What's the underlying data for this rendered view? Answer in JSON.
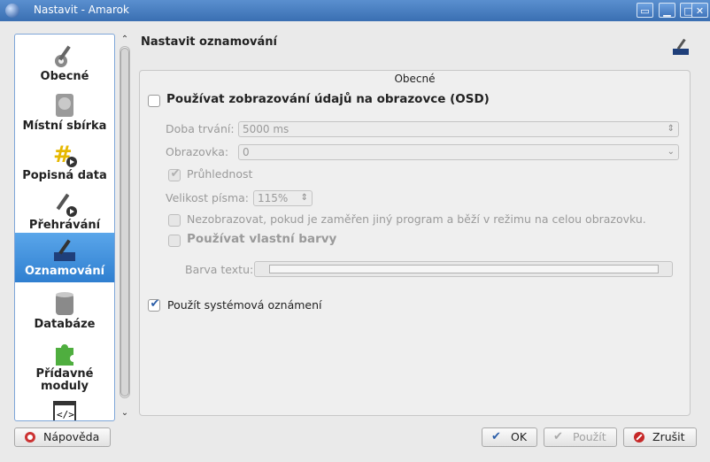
{
  "window": {
    "title": "Nastavit - Amarok"
  },
  "sidebar": {
    "items": [
      {
        "label": "Obecné",
        "icon": "wrench-gear-icon"
      },
      {
        "label": "Místní sbírka",
        "icon": "hard-drive-icon"
      },
      {
        "label": "Popisná data",
        "icon": "metadata-tag-icon"
      },
      {
        "label": "Přehrávání",
        "icon": "playback-tools-icon"
      },
      {
        "label": "Oznamování",
        "icon": "notification-icon",
        "active": true
      },
      {
        "label": "Databáze",
        "icon": "database-icon"
      },
      {
        "label": "Přídavné moduly",
        "line1": "Přídavné",
        "line2": "moduly",
        "icon": "puzzle-piece-icon"
      },
      {
        "label": "",
        "icon": "script-code-icon"
      }
    ]
  },
  "page": {
    "title": "Nastavit oznamování",
    "group_title": "Obecné",
    "osd_enable": {
      "label": "Používat zobrazování údajů na obrazovce (OSD)",
      "checked": false
    },
    "duration": {
      "label": "Doba trvání:",
      "value": "5000 ms"
    },
    "screen": {
      "label": "Obrazovka:",
      "value": "0"
    },
    "transparency": {
      "label": "Průhlednost",
      "checked": true
    },
    "font_size": {
      "label": "Velikost písma:",
      "value": "115%"
    },
    "hide_fullscreen": {
      "label": "Nezobrazovat, pokud je zaměřen jiný program a běží v režimu na celou obrazovku.",
      "checked": false
    },
    "custom_colors": {
      "label": "Používat vlastní barvy",
      "checked": false
    },
    "text_color": {
      "label": "Barva textu:"
    },
    "system_notify": {
      "label": "Použít systémová oznámení",
      "checked": true
    }
  },
  "buttons": {
    "help": "Nápověda",
    "ok": "OK",
    "apply": "Použít",
    "cancel": "Zrušit"
  },
  "colors": {
    "accent": "#2f7fd0",
    "titlebar": "#3a6fb2"
  }
}
